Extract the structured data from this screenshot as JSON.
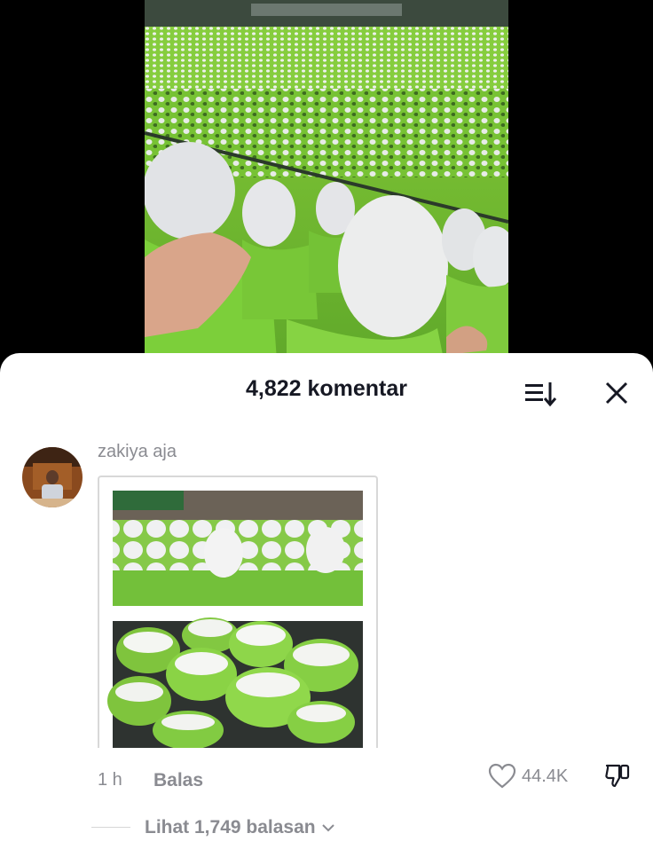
{
  "video": {
    "description_icon": "video-frame"
  },
  "comments_sheet": {
    "title": "4,822 komentar",
    "sort_icon": "sort-icon",
    "close_icon": "close-icon"
  },
  "comment": {
    "username": "zakiya aja",
    "time": "1 h",
    "reply_label": "Balas",
    "like_count": "44.4K",
    "view_replies_label": "Lihat 1,749 balasan"
  },
  "colors": {
    "sheet_bg": "#ffffff",
    "title_text": "#161823",
    "muted_text": "#8a8b91",
    "uniform_green": "#7dbb3a",
    "cake_green": "#8ed64a"
  }
}
